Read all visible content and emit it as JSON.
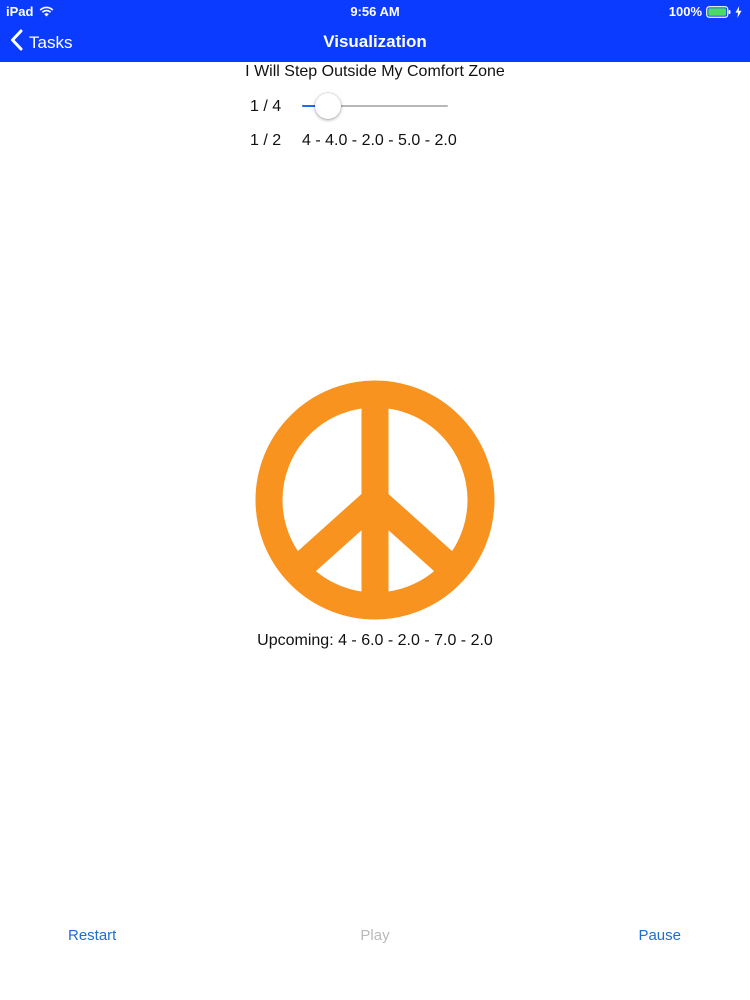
{
  "status_bar": {
    "device": "iPad",
    "time": "9:56 AM",
    "battery": "100%"
  },
  "nav": {
    "back_label": "Tasks",
    "title": "Visualization"
  },
  "session": {
    "title": "I Will Step Outside My Comfort Zone",
    "slider_label": "1 / 4",
    "slider_value_fraction": 0.18,
    "step_label": "1 / 2",
    "pattern": "4 - 4.0 - 2.0 - 5.0 - 2.0",
    "visual_icon": "peace-sign-icon",
    "upcoming": "Upcoming: 4 - 6.0 - 2.0 - 7.0 - 2.0"
  },
  "toolbar": {
    "restart_label": "Restart",
    "play_label": "Play",
    "pause_label": "Pause"
  },
  "colors": {
    "nav_bar": "#0a3bff",
    "accent": "#1a6fd1",
    "symbol": "#f7931e",
    "disabled": "#b9b9b9"
  }
}
